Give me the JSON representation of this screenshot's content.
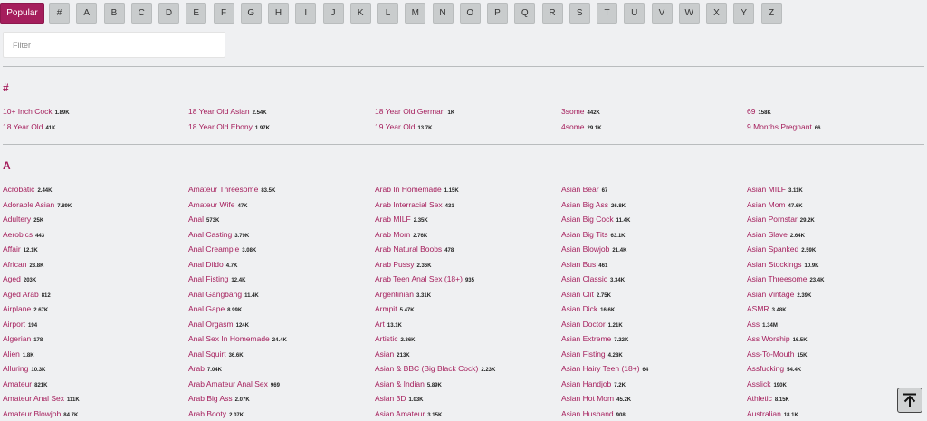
{
  "letters": [
    "Popular",
    "#",
    "A",
    "B",
    "C",
    "D",
    "E",
    "F",
    "G",
    "H",
    "I",
    "J",
    "K",
    "L",
    "M",
    "N",
    "O",
    "P",
    "Q",
    "R",
    "S",
    "T",
    "U",
    "V",
    "W",
    "X",
    "Y",
    "Z"
  ],
  "filter": {
    "placeholder": "Filter",
    "value": ""
  },
  "colors": {
    "accent": "#a51e5c",
    "button_bg": "#c9cccd",
    "page_bg": "#eff0f2"
  },
  "sections": [
    {
      "heading": "#",
      "columns": [
        [
          {
            "name": "10+ Inch Cock",
            "count": "1.89K"
          },
          {
            "name": "18 Year Old",
            "count": "41K"
          }
        ],
        [
          {
            "name": "18 Year Old Asian",
            "count": "2.54K"
          },
          {
            "name": "18 Year Old Ebony",
            "count": "1.97K"
          }
        ],
        [
          {
            "name": "18 Year Old German",
            "count": "1K"
          },
          {
            "name": "19 Year Old",
            "count": "13.7K"
          }
        ],
        [
          {
            "name": "3some",
            "count": "442K"
          },
          {
            "name": "4some",
            "count": "29.1K"
          }
        ],
        [
          {
            "name": "69",
            "count": "158K"
          },
          {
            "name": "9 Months Pregnant",
            "count": "66"
          }
        ]
      ]
    },
    {
      "heading": "A",
      "columns": [
        [
          {
            "name": "Acrobatic",
            "count": "2.44K"
          },
          {
            "name": "Adorable Asian",
            "count": "7.89K"
          },
          {
            "name": "Adultery",
            "count": "25K"
          },
          {
            "name": "Aerobics",
            "count": "443"
          },
          {
            "name": "Affair",
            "count": "12.1K"
          },
          {
            "name": "African",
            "count": "23.8K"
          },
          {
            "name": "Aged",
            "count": "203K"
          },
          {
            "name": "Aged Arab",
            "count": "812"
          },
          {
            "name": "Airplane",
            "count": "2.67K"
          },
          {
            "name": "Airport",
            "count": "194"
          },
          {
            "name": "Algerian",
            "count": "178"
          },
          {
            "name": "Alien",
            "count": "1.8K"
          },
          {
            "name": "Alluring",
            "count": "10.3K"
          },
          {
            "name": "Amateur",
            "count": "821K"
          },
          {
            "name": "Amateur Anal Sex",
            "count": "111K"
          },
          {
            "name": "Amateur Blowjob",
            "count": "84.7K"
          }
        ],
        [
          {
            "name": "Amateur Threesome",
            "count": "83.5K"
          },
          {
            "name": "Amateur Wife",
            "count": "47K"
          },
          {
            "name": "Anal",
            "count": "573K"
          },
          {
            "name": "Anal Casting",
            "count": "3.79K"
          },
          {
            "name": "Anal Creampie",
            "count": "3.08K"
          },
          {
            "name": "Anal Dildo",
            "count": "4.7K"
          },
          {
            "name": "Anal Fisting",
            "count": "12.4K"
          },
          {
            "name": "Anal Gangbang",
            "count": "11.4K"
          },
          {
            "name": "Anal Gape",
            "count": "8.99K"
          },
          {
            "name": "Anal Orgasm",
            "count": "124K"
          },
          {
            "name": "Anal Sex In Homemade",
            "count": "24.4K"
          },
          {
            "name": "Anal Squirt",
            "count": "36.6K"
          },
          {
            "name": "Arab",
            "count": "7.04K"
          },
          {
            "name": "Arab Amateur Anal Sex",
            "count": "969"
          },
          {
            "name": "Arab Big Ass",
            "count": "2.07K"
          },
          {
            "name": "Arab Booty",
            "count": "2.07K"
          }
        ],
        [
          {
            "name": "Arab In Homemade",
            "count": "1.15K"
          },
          {
            "name": "Arab Interracial Sex",
            "count": "431"
          },
          {
            "name": "Arab MILF",
            "count": "2.35K"
          },
          {
            "name": "Arab Mom",
            "count": "2.76K"
          },
          {
            "name": "Arab Natural Boobs",
            "count": "478"
          },
          {
            "name": "Arab Pussy",
            "count": "2.36K"
          },
          {
            "name": "Arab Teen Anal Sex (18+)",
            "count": "935"
          },
          {
            "name": "Argentinian",
            "count": "3.31K"
          },
          {
            "name": "Armpit",
            "count": "5.47K"
          },
          {
            "name": "Art",
            "count": "13.1K"
          },
          {
            "name": "Artistic",
            "count": "2.36K"
          },
          {
            "name": "Asian",
            "count": "213K"
          },
          {
            "name": "Asian & BBC (Big Black Cock)",
            "count": "2.23K"
          },
          {
            "name": "Asian & Indian",
            "count": "5.89K"
          },
          {
            "name": "Asian 3D",
            "count": "1.03K"
          },
          {
            "name": "Asian Amateur",
            "count": "3.15K"
          }
        ],
        [
          {
            "name": "Asian Bear",
            "count": "67"
          },
          {
            "name": "Asian Big Ass",
            "count": "26.8K"
          },
          {
            "name": "Asian Big Cock",
            "count": "11.4K"
          },
          {
            "name": "Asian Big Tits",
            "count": "63.1K"
          },
          {
            "name": "Asian Blowjob",
            "count": "21.4K"
          },
          {
            "name": "Asian Bus",
            "count": "461"
          },
          {
            "name": "Asian Classic",
            "count": "3.34K"
          },
          {
            "name": "Asian Clit",
            "count": "2.75K"
          },
          {
            "name": "Asian Dick",
            "count": "16.6K"
          },
          {
            "name": "Asian Doctor",
            "count": "1.21K"
          },
          {
            "name": "Asian Extreme",
            "count": "7.22K"
          },
          {
            "name": "Asian Fisting",
            "count": "4.28K"
          },
          {
            "name": "Asian Hairy Teen (18+)",
            "count": "64"
          },
          {
            "name": "Asian Handjob",
            "count": "7.2K"
          },
          {
            "name": "Asian Hot Mom",
            "count": "45.2K"
          },
          {
            "name": "Asian Husband",
            "count": "908"
          }
        ],
        [
          {
            "name": "Asian MILF",
            "count": "3.11K"
          },
          {
            "name": "Asian Mom",
            "count": "47.6K"
          },
          {
            "name": "Asian Pornstar",
            "count": "29.2K"
          },
          {
            "name": "Asian Slave",
            "count": "2.64K"
          },
          {
            "name": "Asian Spanked",
            "count": "2.59K"
          },
          {
            "name": "Asian Stockings",
            "count": "10.9K"
          },
          {
            "name": "Asian Threesome",
            "count": "23.4K"
          },
          {
            "name": "Asian Vintage",
            "count": "2.39K"
          },
          {
            "name": "ASMR",
            "count": "3.48K"
          },
          {
            "name": "Ass",
            "count": "1.34M"
          },
          {
            "name": "Ass Worship",
            "count": "16.5K"
          },
          {
            "name": "Ass-To-Mouth",
            "count": "15K"
          },
          {
            "name": "Assfucking",
            "count": "54.4K"
          },
          {
            "name": "Asslick",
            "count": "190K"
          },
          {
            "name": "Athletic",
            "count": "8.15K"
          },
          {
            "name": "Australian",
            "count": "18.1K"
          }
        ]
      ]
    }
  ]
}
